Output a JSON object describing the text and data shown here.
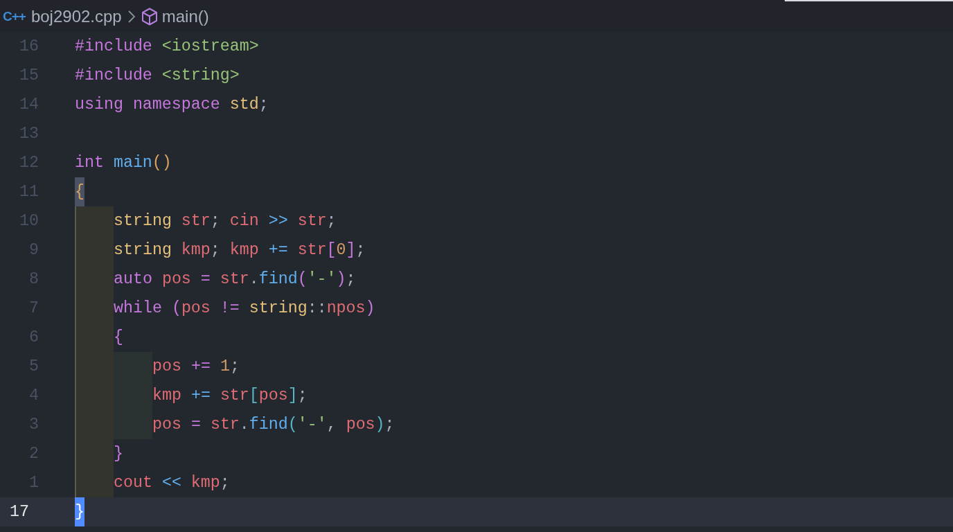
{
  "breadcrumb": {
    "file_icon": "C++",
    "file": "boj2902.cpp",
    "symbol": "main()"
  },
  "lines": [
    {
      "number": "16",
      "selected": false,
      "tokens": [
        {
          "kind": "kw",
          "text": "#include"
        },
        {
          "kind": "str",
          "text": " <iostream>"
        }
      ]
    },
    {
      "number": "15",
      "selected": false,
      "tokens": [
        {
          "kind": "kw",
          "text": "#include"
        },
        {
          "kind": "str",
          "text": " <string>"
        }
      ]
    },
    {
      "number": "14",
      "selected": false,
      "tokens": [
        {
          "kind": "kw",
          "text": "using namespace"
        },
        {
          "kind": "type",
          "text": " std"
        },
        {
          "kind": "plain",
          "text": ";"
        }
      ]
    },
    {
      "number": "13",
      "selected": false
    },
    {
      "number": "12",
      "selected": false,
      "tokens": [
        {
          "kind": "kw",
          "text": "int"
        },
        {
          "kind": "fn",
          "text": " main"
        },
        {
          "kind": "b1",
          "text": "()"
        }
      ]
    },
    {
      "number": "11",
      "selected": false,
      "tokens": [
        {
          "kind": "b1-match",
          "text": "{"
        }
      ]
    },
    {
      "number": "10",
      "selected": false,
      "guides": [
        {
          "active": true
        }
      ],
      "tokens": [
        {
          "kind": "type",
          "text": "string"
        },
        {
          "kind": "var",
          "text": " str"
        },
        {
          "kind": "plain",
          "text": "; "
        },
        {
          "kind": "var",
          "text": "cin"
        },
        {
          "kind": "op",
          "text": " >>"
        },
        {
          "kind": "var",
          "text": " str"
        },
        {
          "kind": "plain",
          "text": ";"
        }
      ]
    },
    {
      "number": "9",
      "selected": false,
      "guides": [
        {
          "active": true
        }
      ],
      "tokens": [
        {
          "kind": "type",
          "text": "string"
        },
        {
          "kind": "var",
          "text": " kmp"
        },
        {
          "kind": "plain",
          "text": "; "
        },
        {
          "kind": "var",
          "text": "kmp"
        },
        {
          "kind": "op",
          "text": " +="
        },
        {
          "kind": "var",
          "text": " str"
        },
        {
          "kind": "b2",
          "text": "["
        },
        {
          "kind": "num",
          "text": "0"
        },
        {
          "kind": "b2",
          "text": "]"
        },
        {
          "kind": "plain",
          "text": ";"
        }
      ]
    },
    {
      "number": "8",
      "selected": false,
      "guides": [
        {
          "active": true
        }
      ],
      "tokens": [
        {
          "kind": "kw",
          "text": "auto"
        },
        {
          "kind": "var",
          "text": " pos"
        },
        {
          "kind": "kw",
          "text": " ="
        },
        {
          "kind": "var",
          "text": " str"
        },
        {
          "kind": "plain",
          "text": "."
        },
        {
          "kind": "fn",
          "text": "find"
        },
        {
          "kind": "b2",
          "text": "("
        },
        {
          "kind": "str",
          "text": "'-'"
        },
        {
          "kind": "b2",
          "text": ")"
        },
        {
          "kind": "plain",
          "text": ";"
        }
      ]
    },
    {
      "number": "7",
      "selected": false,
      "guides": [
        {
          "active": true
        }
      ],
      "tokens": [
        {
          "kind": "kw",
          "text": "while"
        },
        {
          "kind": "b2",
          "text": " ("
        },
        {
          "kind": "var",
          "text": "pos"
        },
        {
          "kind": "kw",
          "text": " !="
        },
        {
          "kind": "type",
          "text": " string"
        },
        {
          "kind": "plain",
          "text": "::"
        },
        {
          "kind": "var",
          "text": "npos"
        },
        {
          "kind": "b2",
          "text": ")"
        }
      ]
    },
    {
      "number": "6",
      "selected": false,
      "guides": [
        {
          "active": true
        }
      ],
      "tokens": [
        {
          "kind": "b2",
          "text": "{"
        }
      ]
    },
    {
      "number": "5",
      "selected": false,
      "guides": [
        {
          "active": true
        },
        {
          "active": false
        }
      ],
      "tokens": [
        {
          "kind": "var",
          "text": "pos"
        },
        {
          "kind": "kw",
          "text": " +="
        },
        {
          "kind": "num",
          "text": " 1"
        },
        {
          "kind": "plain",
          "text": ";"
        }
      ]
    },
    {
      "number": "4",
      "selected": false,
      "guides": [
        {
          "active": true
        },
        {
          "active": false
        }
      ],
      "tokens": [
        {
          "kind": "var",
          "text": "kmp"
        },
        {
          "kind": "op",
          "text": " +="
        },
        {
          "kind": "var",
          "text": " str"
        },
        {
          "kind": "b3",
          "text": "["
        },
        {
          "kind": "var",
          "text": "pos"
        },
        {
          "kind": "b3",
          "text": "]"
        },
        {
          "kind": "plain",
          "text": ";"
        }
      ]
    },
    {
      "number": "3",
      "selected": false,
      "guides": [
        {
          "active": true
        },
        {
          "active": false
        }
      ],
      "tokens": [
        {
          "kind": "var",
          "text": "pos"
        },
        {
          "kind": "kw",
          "text": " ="
        },
        {
          "kind": "var",
          "text": " str"
        },
        {
          "kind": "plain",
          "text": "."
        },
        {
          "kind": "fn",
          "text": "find"
        },
        {
          "kind": "b3",
          "text": "("
        },
        {
          "kind": "str",
          "text": "'-'"
        },
        {
          "kind": "plain",
          "text": ", "
        },
        {
          "kind": "var",
          "text": "pos"
        },
        {
          "kind": "b3",
          "text": ")"
        },
        {
          "kind": "plain",
          "text": ";"
        }
      ]
    },
    {
      "number": "2",
      "selected": false,
      "guides": [
        {
          "active": true
        }
      ],
      "tokens": [
        {
          "kind": "b2",
          "text": "}"
        }
      ]
    },
    {
      "number": "1",
      "selected": false,
      "guides": [
        {
          "active": true
        }
      ],
      "tokens": [
        {
          "kind": "var",
          "text": "cout"
        },
        {
          "kind": "op",
          "text": " <<"
        },
        {
          "kind": "var",
          "text": " kmp"
        },
        {
          "kind": "plain",
          "text": ";"
        }
      ]
    },
    {
      "number": "17",
      "selected": true,
      "tokens": [
        {
          "kind": "b1-cursor",
          "text": "}"
        }
      ]
    }
  ]
}
